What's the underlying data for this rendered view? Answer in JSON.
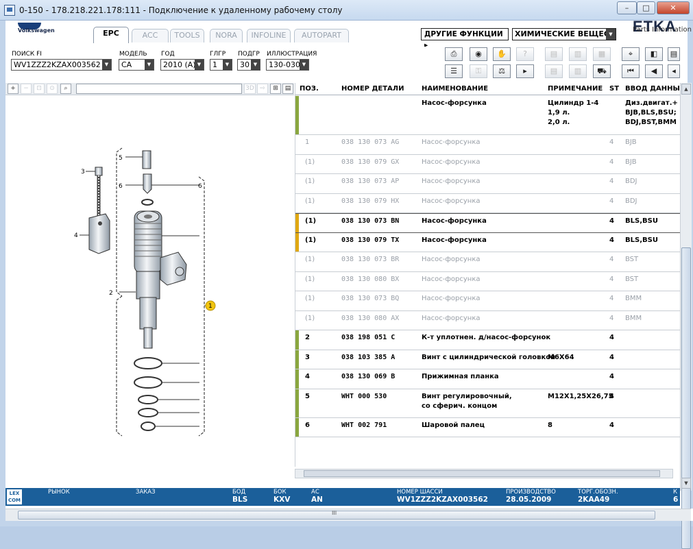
{
  "window": {
    "title": "0-150 - 178.218.221.178:111 - Подключение к удаленному рабочему столу",
    "min_label": "–",
    "max_label": "□",
    "close_label": "✕"
  },
  "header": {
    "logo_text": "Volkswagen",
    "tabs": [
      {
        "label": "EPC",
        "active": true
      },
      {
        "label": "ACC",
        "active": false
      },
      {
        "label": "TOOLS",
        "active": false
      },
      {
        "label": "NORA",
        "active": false
      },
      {
        "label": "INFOLINE",
        "active": false
      },
      {
        "label": "AUTOPART",
        "active": false
      }
    ],
    "functions_label": "ДРУГИЕ ФУНКЦИИ ▸",
    "chem_select": "ХИМИЧЕСКИЕ ВЕЩЕСТВА",
    "brand_title": "ETKA",
    "brand_subtitle": "Parts Information"
  },
  "filters": {
    "search": {
      "label": "ПОИСК FI",
      "value": "WV1ZZZ2KZAX003562"
    },
    "model": {
      "label": "МОДЕЛЬ",
      "value": "CA"
    },
    "year": {
      "label": "ГОД",
      "value": "2010 (A)"
    },
    "main_group": {
      "label": "ГЛГР",
      "value": "1"
    },
    "sub_group": {
      "label": "ПОДГР",
      "value": "30"
    },
    "illustration": {
      "label": "ИЛЛЮСТРАЦИЯ",
      "value": "130-030"
    }
  },
  "toolbar_icons": [
    "printer-icon",
    "disc-icon",
    "handshake-icon",
    "query-icon",
    "elsa-icon",
    "erwin-icon",
    "pin-icon",
    "prev-page-icon",
    "list-icon",
    "key-icon",
    "scale-icon",
    "play-icon",
    "elsa2-icon",
    "dispo-icon",
    "cart-icon",
    "first-icon",
    "back-icon"
  ],
  "drawing": {
    "callouts": [
      "1",
      "2",
      "3",
      "4",
      "5",
      "6",
      "5",
      "6"
    ]
  },
  "table": {
    "columns": [
      "ПОЗ.",
      "НОМЕР ДЕТАЛИ",
      "НАИМЕНОВАНИЕ",
      "ПРИМЕЧАНИЕ",
      "ST",
      "ВВОД ДАННЫХ"
    ],
    "rows": [
      {
        "pos": "",
        "part": "",
        "name": "Насос-форсунка",
        "note": "Цилиндр 1-4\n1,9 л.\n2,0 л.",
        "st": "",
        "data": "Диз.двигат.+\nBJB,BLS,BSU;\nBDJ,BST,BMM",
        "style": "header",
        "bar": "#8aa63f"
      },
      {
        "pos": "1",
        "part": "038 130 073 AG",
        "name": "Насос-форсунка",
        "note": "",
        "st": "4",
        "data": "BJB",
        "style": "gray",
        "bar": ""
      },
      {
        "pos": "(1)",
        "part": "038 130 079 GX",
        "name": "Насос-форсунка",
        "note": "",
        "st": "4",
        "data": "BJB",
        "style": "gray",
        "bar": ""
      },
      {
        "pos": "(1)",
        "part": "038 130 073 AP",
        "name": "Насос-форсунка",
        "note": "",
        "st": "4",
        "data": "BDJ",
        "style": "gray",
        "bar": ""
      },
      {
        "pos": "(1)",
        "part": "038 130 079 HX",
        "name": "Насос-форсунка",
        "note": "",
        "st": "4",
        "data": "BDJ",
        "style": "gray",
        "bar": ""
      },
      {
        "pos": "(1)",
        "part": "038 130 073 BN",
        "name": "Насос-форсунка",
        "note": "",
        "st": "4",
        "data": "BLS,BSU",
        "style": "selected",
        "bar": "#e0a812"
      },
      {
        "pos": "(1)",
        "part": "038 130 079 TX",
        "name": "Насос-форсунка",
        "note": "",
        "st": "4",
        "data": "BLS,BSU",
        "style": "normal",
        "bar": "#e0a812"
      },
      {
        "pos": "(1)",
        "part": "038 130 073 BR",
        "name": "Насос-форсунка",
        "note": "",
        "st": "4",
        "data": "BST",
        "style": "gray",
        "bar": ""
      },
      {
        "pos": "(1)",
        "part": "038 130 080 BX",
        "name": "Насос-форсунка",
        "note": "",
        "st": "4",
        "data": "BST",
        "style": "gray",
        "bar": ""
      },
      {
        "pos": "(1)",
        "part": "038 130 073 BQ",
        "name": "Насос-форсунка",
        "note": "",
        "st": "4",
        "data": "BMM",
        "style": "gray",
        "bar": ""
      },
      {
        "pos": "(1)",
        "part": "038 130 080 AX",
        "name": "Насос-форсунка",
        "note": "",
        "st": "4",
        "data": "BMM",
        "style": "gray",
        "bar": ""
      },
      {
        "pos": "2",
        "part": "038 198 051 C",
        "name": "К-т уплотнен. д/насос-форсунок",
        "note": "",
        "st": "4",
        "data": "",
        "style": "normal",
        "bar": "#8aa63f"
      },
      {
        "pos": "3",
        "part": "038 103 385 A",
        "name": "Винт с цилиндрической головкой",
        "note": "M6X64",
        "st": "4",
        "data": "",
        "style": "normal",
        "bar": "#8aa63f"
      },
      {
        "pos": "4",
        "part": "038 130 069 B",
        "name": "Прижимная планка",
        "note": "",
        "st": "4",
        "data": "",
        "style": "normal",
        "bar": "#8aa63f"
      },
      {
        "pos": "5",
        "part": "WHT 000 530",
        "name": "Винт регулировочный,\nсо сферич. концом",
        "note": "M12X1,25X26,75",
        "st": "4",
        "data": "",
        "style": "normal",
        "bar": "#8aa63f"
      },
      {
        "pos": "6",
        "part": "WHT 002 791",
        "name": "Шаровой палец",
        "note": "8",
        "st": "4",
        "data": "",
        "style": "normal",
        "bar": "#8aa63f"
      }
    ]
  },
  "status": {
    "lexcom": "LEX\nCOM",
    "market_label": "РЫНОК",
    "order_label": "ЗАКАЗ",
    "bod_label": "БОД",
    "bod_value": "BLS",
    "box_label": "БОК",
    "box_value": "KXV",
    "ac_label": "АС",
    "ac_value": "AN",
    "chassis_label": "НОМЕР ШАССИ",
    "chassis_value": "WV1ZZZ2KZAX003562",
    "prod_label": "ПРОИЗВОДСТВО",
    "prod_value": "28.05.2009",
    "trade_label": "ТОРГ.ОБОЗН.",
    "trade_value": "2KAA49",
    "k_label": "К",
    "k_value": "6"
  },
  "scroll": {
    "grip": "III"
  },
  "colors": {
    "status_bg": "#1b5f9a",
    "green_bar": "#8aa63f",
    "amber_bar": "#e0a812"
  }
}
